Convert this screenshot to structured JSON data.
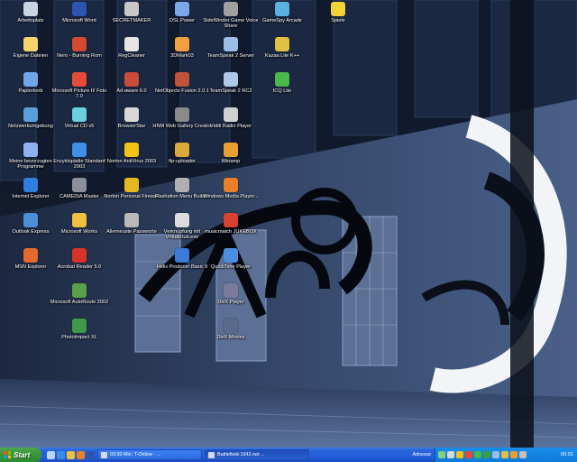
{
  "desktop": {
    "columns": [
      [
        {
          "label": "Arbeitsplatz",
          "icon": "computer-icon",
          "color": "#c9d4e2"
        },
        {
          "label": "Eigene Dateien",
          "icon": "folder-icon",
          "color": "#f4d46b"
        },
        {
          "label": "Papierkorb",
          "icon": "recycle-bin-icon",
          "color": "#6fa7e6"
        },
        {
          "label": "Netzwerkumgebung",
          "icon": "network-icon",
          "color": "#5aa0d8"
        },
        {
          "label": "Meine bevorzugten Programme",
          "icon": "shortcut-icon",
          "color": "#8fb1f0"
        },
        {
          "label": "Internet Explorer",
          "icon": "ie-icon",
          "color": "#2e7fe0"
        },
        {
          "label": "Outlook Express",
          "icon": "mail-icon",
          "color": "#4b8fd8"
        },
        {
          "label": "MSN Explorer",
          "icon": "butterfly-icon",
          "color": "#e36a2c"
        }
      ],
      [
        {
          "label": "Microsoft Word",
          "icon": "word-icon",
          "color": "#2d55b0"
        },
        {
          "label": "Nero - Burning Rom",
          "icon": "nero-icon",
          "color": "#d24a30"
        },
        {
          "label": "Microsoft Picture It! Foto 7.0",
          "icon": "picture-icon",
          "color": "#e64b3a"
        },
        {
          "label": "Virtual CD v5",
          "icon": "cd-icon",
          "color": "#6ad0e0"
        },
        {
          "label": "Enzyklopädie Standard 2003",
          "icon": "encarta-icon",
          "color": "#3e8fe8"
        },
        {
          "label": "CAMEDIA Master",
          "icon": "camera-icon",
          "color": "#8a8f99"
        },
        {
          "label": "Microsoft Works",
          "icon": "works-icon",
          "color": "#f0c040"
        },
        {
          "label": "Acrobat Reader 5.0",
          "icon": "acrobat-icon",
          "color": "#d8332a"
        },
        {
          "label": "Microsoft AutoRoute 2002",
          "icon": "autoroute-icon",
          "color": "#5aa048"
        },
        {
          "label": "PhotoImpact XL",
          "icon": "photoimpact-icon",
          "color": "#3e9a4a"
        }
      ],
      [
        {
          "label": "SECRETMAKER",
          "icon": "secretmaker-icon",
          "color": "#c8c8c8"
        },
        {
          "label": "RegCleaner",
          "icon": "regcleaner-icon",
          "color": "#e6e6e6"
        },
        {
          "label": "Ad-aware 6.0",
          "icon": "adaware-icon",
          "color": "#c94b3a"
        },
        {
          "label": "BrowserStar",
          "icon": "browserstar-icon",
          "color": "#d8d8d8"
        },
        {
          "label": "Norton AntiVirus 2003",
          "icon": "norton-icon",
          "color": "#f2c314"
        },
        {
          "label": "Norton Personal Firewall",
          "icon": "firewall-icon",
          "color": "#e6b820"
        },
        {
          "label": "Allerneuste Passworte",
          "icon": "key-icon",
          "color": "#b9b9b9"
        }
      ],
      [
        {
          "label": "DSL Power",
          "icon": "dsl-icon",
          "color": "#7aa8e8"
        },
        {
          "label": "3DMark03",
          "icon": "3dmark-icon",
          "color": "#f0a040"
        },
        {
          "label": "NetObjects Fusion 2.0.1",
          "icon": "fusion-icon",
          "color": "#c0533a"
        },
        {
          "label": "HNM Web Gallery Creator",
          "icon": "gallery-icon",
          "color": "#8a8a8a"
        },
        {
          "label": "ftp-uploader",
          "icon": "ftp-icon",
          "color": "#d9a93a"
        },
        {
          "label": "Flashation Menu Builder",
          "icon": "flash-icon",
          "color": "#b0b0b0"
        },
        {
          "label": "Verknüpfung mit VirtualDub.exe",
          "icon": "virtualdub-icon",
          "color": "#dcdcdc"
        },
        {
          "label": "Helix Producer Basic 9",
          "icon": "helix-icon",
          "color": "#3b7bd8"
        }
      ],
      [
        {
          "label": "SideWinder Game Voice Share",
          "icon": "sidewinder-icon",
          "color": "#a0a0a0"
        },
        {
          "label": "TeamSpeak 2 Server",
          "icon": "teamspeak-icon",
          "color": "#9bbde8"
        },
        {
          "label": "TeamSpeak 2 RC2",
          "icon": "teamspeak-rc2-icon",
          "color": "#b0c8e8"
        },
        {
          "label": "Viddi Radio Player",
          "icon": "radio-icon",
          "color": "#d0d0d0"
        },
        {
          "label": "Winamp",
          "icon": "winamp-icon",
          "color": "#e8a030"
        },
        {
          "label": "Windows Media Player...",
          "icon": "media-player-icon",
          "color": "#e8802a"
        },
        {
          "label": "musicmatch JUKEBOX",
          "icon": "jukebox-icon",
          "color": "#d84030"
        },
        {
          "label": "QuickTime Player",
          "icon": "quicktime-icon",
          "color": "#4a8ee0"
        },
        {
          "label": "DivX Player",
          "icon": "divx-icon",
          "color": "#7a7a9a"
        },
        {
          "label": "DivX Movies",
          "icon": "divx-movies-icon",
          "color": "#5a6a8a"
        }
      ],
      [
        {
          "label": "GameSpy Arcade",
          "icon": "gamespy-icon",
          "color": "#5ab0e0"
        },
        {
          "label": "Kazaa Lite K++",
          "icon": "kazaa-icon",
          "color": "#e0c040"
        },
        {
          "label": "ICQ Lite",
          "icon": "icq-icon",
          "color": "#4ab84a"
        }
      ],
      [
        {
          "label": "Spiele",
          "icon": "star-folder-icon",
          "color": "#f4d23a"
        }
      ]
    ]
  },
  "taskbar": {
    "start_label": "Start",
    "quicklaunch": [
      {
        "icon": "show-desktop-icon",
        "color": "#bcd3f5"
      },
      {
        "icon": "ie-quicklaunch-icon",
        "color": "#3a8ae8"
      },
      {
        "icon": "outlook-quicklaunch-icon",
        "color": "#f0c040"
      },
      {
        "icon": "media-quicklaunch-icon",
        "color": "#e8802a"
      },
      {
        "icon": "word-quicklaunch-icon",
        "color": "#2d55b0"
      }
    ],
    "tasks": [
      {
        "label": "03:30 Min. T-Online - ...",
        "active": false
      },
      {
        "label": "Battlefield-1942.net ...",
        "active": true
      }
    ],
    "language_label": "Adresse",
    "tray_icons": [
      {
        "icon": "network-tray-icon",
        "color": "#7fd07f"
      },
      {
        "icon": "volume-tray-icon",
        "color": "#d9d9d9"
      },
      {
        "icon": "antivirus-tray-icon",
        "color": "#f2c314"
      },
      {
        "icon": "firewall-tray-icon",
        "color": "#e84a30"
      },
      {
        "icon": "msn-tray-icon",
        "color": "#4ab84a"
      },
      {
        "icon": "icq-tray-icon",
        "color": "#3aa03a"
      },
      {
        "icon": "teamspeak-tray-icon",
        "color": "#9bbde8"
      },
      {
        "icon": "kazaa-tray-icon",
        "color": "#e0c040"
      },
      {
        "icon": "winamp-tray-icon",
        "color": "#e8a030"
      },
      {
        "icon": "clock-tray-icon",
        "color": "#c0c0c0"
      }
    ],
    "clock": "00:01"
  }
}
